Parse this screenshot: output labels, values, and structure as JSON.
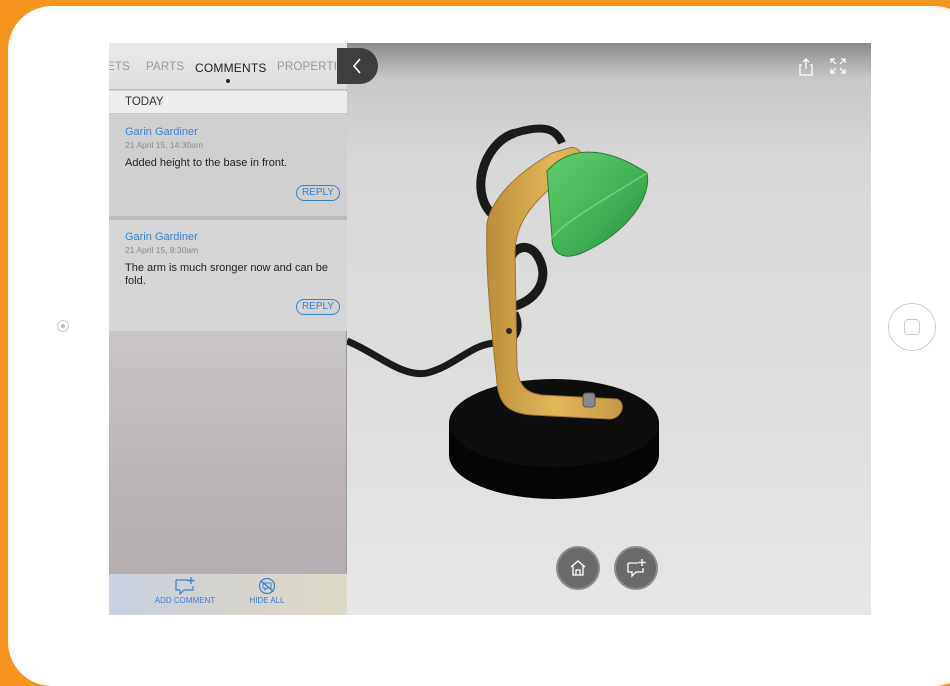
{
  "tabs": [
    {
      "label": "ETS"
    },
    {
      "label": "PARTS"
    },
    {
      "label": "COMMENTS"
    },
    {
      "label": "PROPERTIES"
    }
  ],
  "active_tab": "COMMENTS",
  "section_header": "TODAY",
  "comments": [
    {
      "author": "Garin Gardiner",
      "date": "21 April 15, 14:30am",
      "text": "Added height to the base in front.",
      "reply_label": "REPLY"
    },
    {
      "author": "Garin Gardiner",
      "date": "21 April 15, 8:30am",
      "text": "The arm is much sronger now and can be fold.",
      "reply_label": "REPLY"
    }
  ],
  "bottom_bar": {
    "add_comment_label": "ADD COMMENT",
    "hide_all_label": "HIDE ALL"
  },
  "viewer": {
    "icons": [
      "share-icon",
      "fullscreen-icon",
      "home-icon",
      "add-comment-icon",
      "chevron-left-icon"
    ]
  },
  "colors": {
    "frame": "#f7941d",
    "accent": "#3a7fd0",
    "lamp_arm": "#d9a843",
    "lamp_shade": "#3fae52"
  }
}
